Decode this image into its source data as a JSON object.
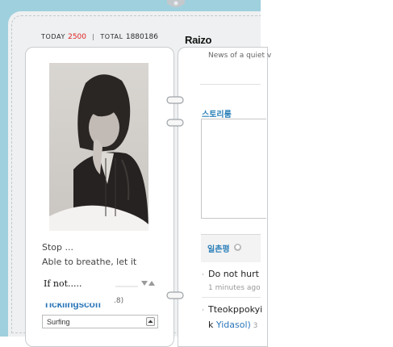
{
  "counter": {
    "today_label": "TODAY",
    "today_value": "2500",
    "separator": "|",
    "total_label": "TOTAL",
    "total_value": "1880186"
  },
  "header": {
    "title": "Raizo"
  },
  "profile": {
    "caption_line1": "Stop ...",
    "caption_line2": "Able to breathe, let it",
    "scroller_text": "If not.....",
    "faded_text": "Ticklingscoff",
    "faded_control": ".8)",
    "menu_select_value": "Surfing"
  },
  "main": {
    "news_text": "News of a quiet v",
    "story_title": "스토리룸",
    "oneline_title": "일촌평",
    "comments": [
      {
        "text": "Do not hurt ",
        "time": "1 minutes ago"
      },
      {
        "text": "Tteokppokyi",
        "text_line2_prefix": "k ",
        "text_line2_link": "Yidasol)",
        "time_suffix": " 3"
      }
    ]
  },
  "colors": {
    "page_background": "#9fd0de",
    "today_count": "#e02020",
    "section_title": "#2a7fb8"
  }
}
